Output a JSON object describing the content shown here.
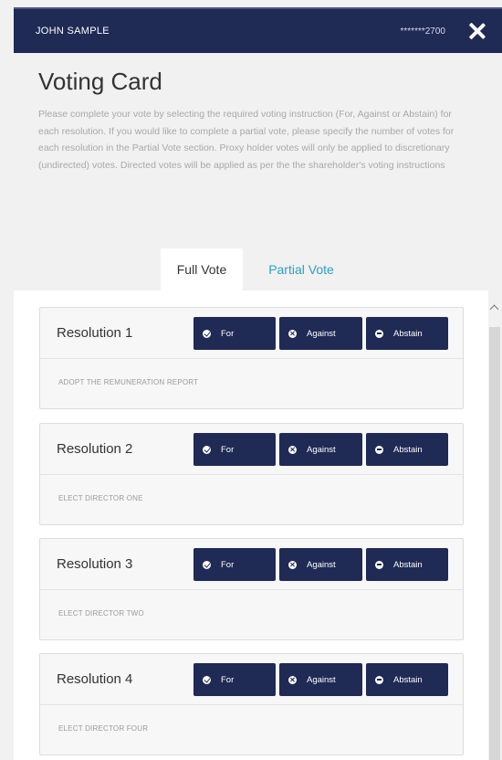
{
  "header": {
    "user_name": "JOHN SAMPLE",
    "account_masked": "*******2700"
  },
  "card": {
    "title": "Voting Card",
    "description": "Please complete your vote by selecting the required voting instruction (For, Against or Abstain) for each resolution. If you would like to complete a partial vote, please specify the number of votes for each resolution in the Partial Vote section. Proxy holder votes will only be applied to discretionary (undirected) votes. Directed votes will be applied as per the the shareholder's voting instructions"
  },
  "tabs": [
    {
      "label": "Full Vote",
      "active": true
    },
    {
      "label": "Partial Vote",
      "active": false
    }
  ],
  "vote_options": {
    "for": "For",
    "against": "Against",
    "abstain": "Abstain"
  },
  "resolutions": [
    {
      "name": "Resolution 1",
      "description": "ADOPT THE REMUNERATION REPORT"
    },
    {
      "name": "Resolution 2",
      "description": "ELECT DIRECTOR ONE"
    },
    {
      "name": "Resolution 3",
      "description": "ELECT DIRECTOR TWO"
    },
    {
      "name": "Resolution 4",
      "description": "ELECT DIRECTOR FOUR"
    }
  ],
  "colors": {
    "header_bg": "#1f2a55",
    "button_bg": "#1f2a55",
    "tab_link": "#2aa0c8"
  },
  "icons": {
    "close": "close-icon",
    "for": "check-circle-icon",
    "against": "x-circle-icon",
    "abstain": "minus-circle-icon",
    "scroll_up": "chevron-up-icon"
  }
}
